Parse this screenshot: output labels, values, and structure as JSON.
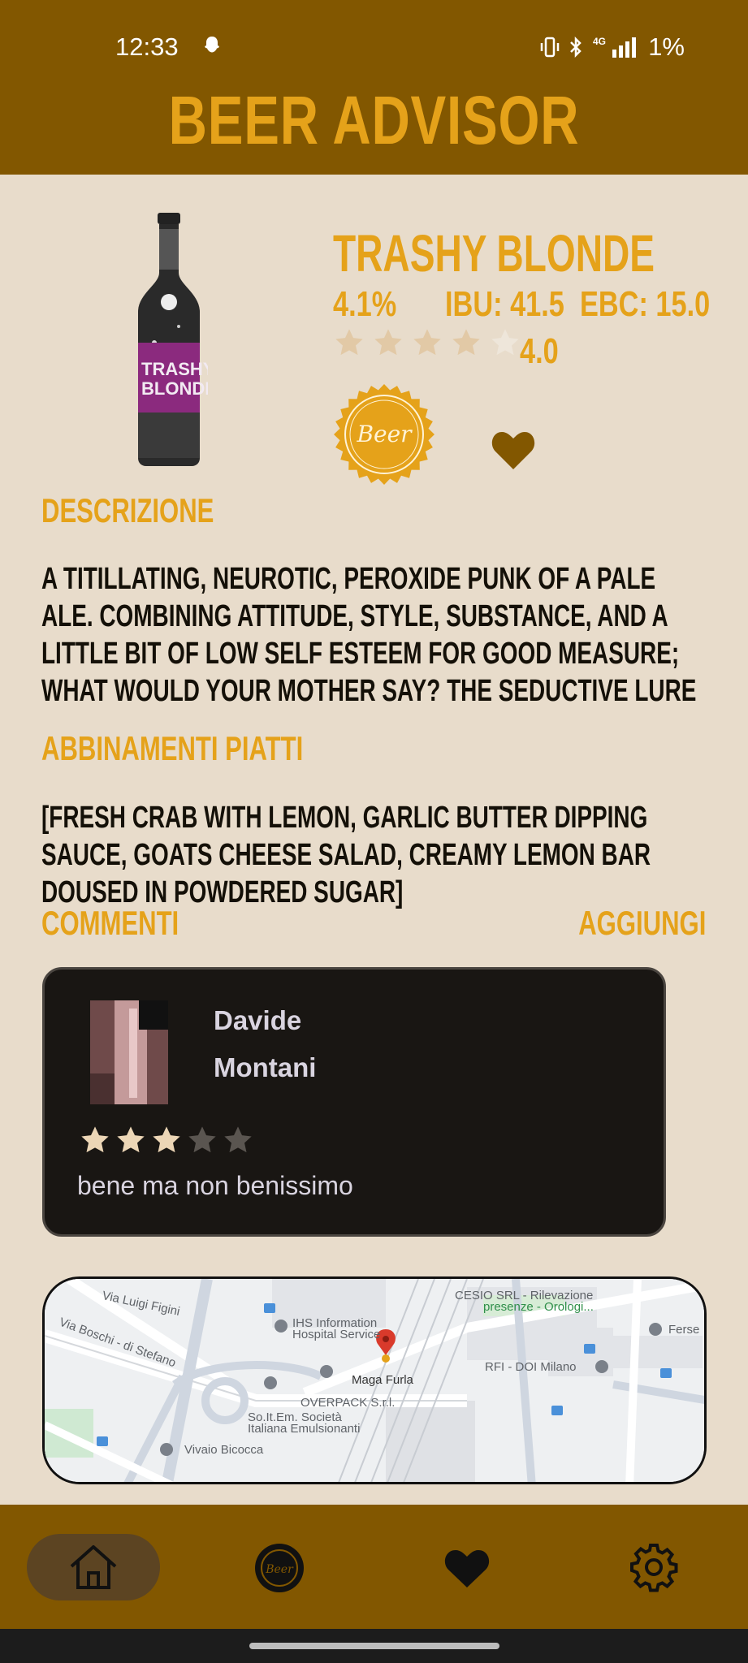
{
  "status_bar": {
    "time": "12:33",
    "network": "4G",
    "battery": "1%"
  },
  "app": {
    "title": "BEER ADVISOR"
  },
  "beer": {
    "name": "TRASHY BLONDE",
    "abv": "4.1%",
    "ibu": "IBU: 41.5",
    "ebc": "EBC: 15.0",
    "rating": "4.0",
    "rating_value": 4.0,
    "rating_max": 5,
    "favorite": true
  },
  "description": {
    "title": "DESCRIZIONE",
    "text": "A titillating, neurotic, peroxide punk of a Pale Ale. Combining attitude, style, substance, and a little bit of low self esteem for good measure; what would your mother say? The seductive lure of the sassy passion fruit hop proves too much to resist. All that"
  },
  "food_pairing": {
    "title": "ABBINAMENTI PIATTI",
    "text": "[Fresh crab with lemon, Garlic butter dipping sauce, Goats cheese salad, Creamy lemon bar doused in powdered sugar]"
  },
  "comments": {
    "title": "COMMENTI",
    "add_label": "AGGIUNGI",
    "items": [
      {
        "first_name": "Davide",
        "last_name": "Montani",
        "rating": 3,
        "rating_max": 5,
        "text": "bene ma non benissimo"
      }
    ]
  },
  "map": {
    "labels": {
      "street1": "Via Luigi Figini",
      "street2": "Via Boschi - di Stefano",
      "poi1": "IHS Information",
      "poi1b": "Hospital Service",
      "poi2": "CESIO SRL - Rilevazione",
      "poi2b": "presenze - Orologi...",
      "poi3": "Maga Furla",
      "poi4": "OVERPACK S.r.l.",
      "poi5": "So.It.Em. Società",
      "poi5b": "Italiana Emulsionanti",
      "poi6": "RFI - DOI Milano",
      "poi7": "Vivaio Bicocca",
      "poi8": "Ferse"
    }
  },
  "nav": {
    "items": [
      "home-icon",
      "beer-badge-icon",
      "heart-icon",
      "gear-icon"
    ],
    "active": "home-icon"
  },
  "colors": {
    "bar": "#825700",
    "accent": "#e5a21a",
    "background": "#e8dccb",
    "card": "#191613"
  }
}
